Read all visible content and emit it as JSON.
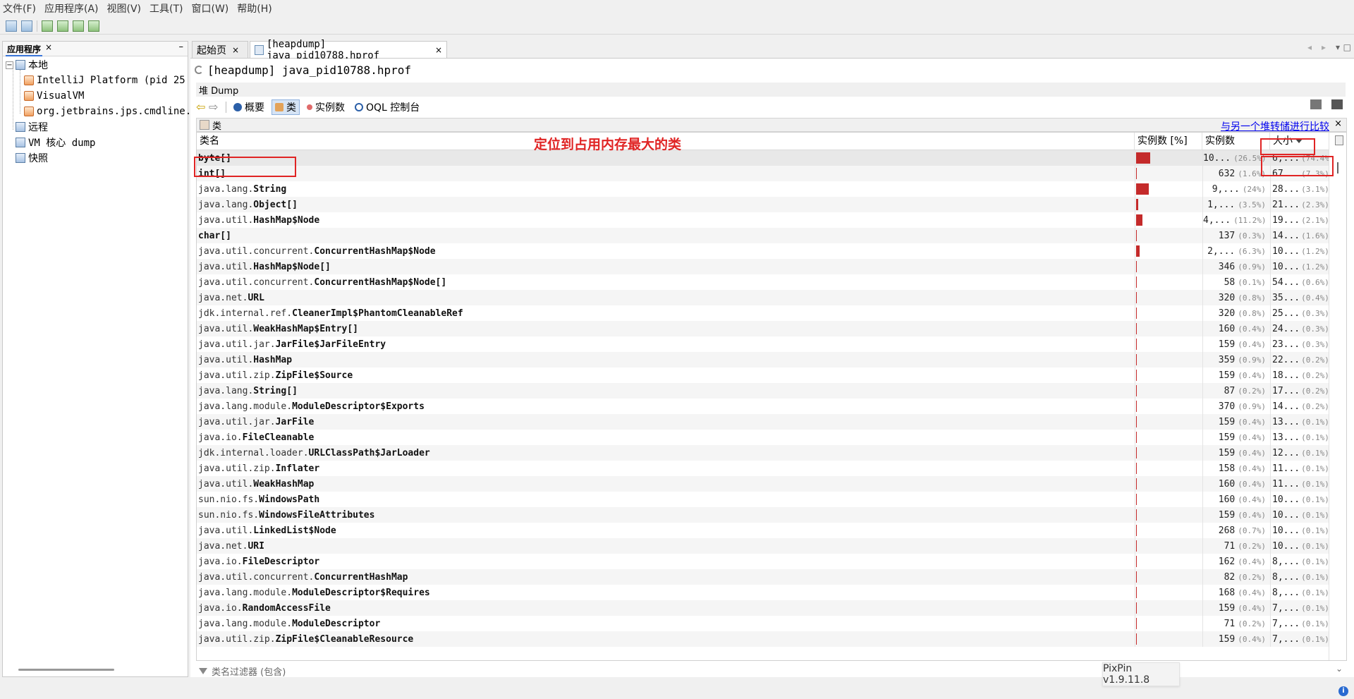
{
  "menubar": [
    "文件(F)",
    "应用程序(A)",
    "视图(V)",
    "工具(T)",
    "窗口(W)",
    "帮助(H)"
  ],
  "left_panel": {
    "tab_label": "应用程序",
    "tab_close": "×",
    "minimize": "–",
    "tree": {
      "local": "本地",
      "intellij": "IntelliJ Platform (pid 25",
      "visualvm": "VisualVM",
      "jps": "org.jetbrains.jps.cmdline.",
      "remote": "远程",
      "vm_core": "VM 核心 dump",
      "snapshot": "快照"
    }
  },
  "editor_tabs": {
    "start_page": "起始页",
    "heapdump": "[heapdump] java_pid10788.hprof",
    "close": "×"
  },
  "document": {
    "title": "[heapdump] java_pid10788.hprof",
    "heap_label": "堆 Dump",
    "views": {
      "summary": "概要",
      "classes": "类",
      "instances": "实例数",
      "oql": "OQL 控制台"
    }
  },
  "classes_panel": {
    "title": "类",
    "compare_link": "与另一个堆转储进行比较",
    "close": "×"
  },
  "table": {
    "headers": {
      "class_name": "类名",
      "instances_pct": "实例数 [%]",
      "instances": "实例数",
      "size": "大小"
    },
    "sort_column": "size",
    "rows": [
      {
        "pkg": "",
        "cls": "byte[]",
        "bar": 0.265,
        "count": "10...",
        "count_pct": "(26.5%)",
        "size": "6,...",
        "size_pct": "(74.4%)"
      },
      {
        "pkg": "",
        "cls": "int[]",
        "bar": 0.016,
        "count": "632",
        "count_pct": "(1.6%)",
        "size": "67...",
        "size_pct": "(7.3%)"
      },
      {
        "pkg": "java.lang.",
        "cls": "String",
        "bar": 0.24,
        "count": "9,...",
        "count_pct": "(24%)",
        "size": "28...",
        "size_pct": "(3.1%)"
      },
      {
        "pkg": "java.lang.",
        "cls": "Object[]",
        "bar": 0.035,
        "count": "1,...",
        "count_pct": "(3.5%)",
        "size": "21...",
        "size_pct": "(2.3%)"
      },
      {
        "pkg": "java.util.",
        "cls": "HashMap$Node",
        "bar": 0.112,
        "count": "4,...",
        "count_pct": "(11.2%)",
        "size": "19...",
        "size_pct": "(2.1%)"
      },
      {
        "pkg": "",
        "cls": "char[]",
        "bar": 0.003,
        "count": "137",
        "count_pct": "(0.3%)",
        "size": "14...",
        "size_pct": "(1.6%)"
      },
      {
        "pkg": "java.util.concurrent.",
        "cls": "ConcurrentHashMap$Node",
        "bar": 0.063,
        "count": "2,...",
        "count_pct": "(6.3%)",
        "size": "10...",
        "size_pct": "(1.2%)"
      },
      {
        "pkg": "java.util.",
        "cls": "HashMap$Node[]",
        "bar": 0.009,
        "count": "346",
        "count_pct": "(0.9%)",
        "size": "10...",
        "size_pct": "(1.2%)"
      },
      {
        "pkg": "java.util.concurrent.",
        "cls": "ConcurrentHashMap$Node[]",
        "bar": 0.001,
        "count": "58",
        "count_pct": "(0.1%)",
        "size": "54...",
        "size_pct": "(0.6%)"
      },
      {
        "pkg": "java.net.",
        "cls": "URL",
        "bar": 0.008,
        "count": "320",
        "count_pct": "(0.8%)",
        "size": "35...",
        "size_pct": "(0.4%)"
      },
      {
        "pkg": "jdk.internal.ref.",
        "cls": "CleanerImpl$PhantomCleanableRef",
        "bar": 0.008,
        "count": "320",
        "count_pct": "(0.8%)",
        "size": "25...",
        "size_pct": "(0.3%)"
      },
      {
        "pkg": "java.util.",
        "cls": "WeakHashMap$Entry[]",
        "bar": 0.004,
        "count": "160",
        "count_pct": "(0.4%)",
        "size": "24...",
        "size_pct": "(0.3%)"
      },
      {
        "pkg": "java.util.jar.",
        "cls": "JarFile$JarFileEntry",
        "bar": 0.004,
        "count": "159",
        "count_pct": "(0.4%)",
        "size": "23...",
        "size_pct": "(0.3%)"
      },
      {
        "pkg": "java.util.",
        "cls": "HashMap",
        "bar": 0.009,
        "count": "359",
        "count_pct": "(0.9%)",
        "size": "22...",
        "size_pct": "(0.2%)"
      },
      {
        "pkg": "java.util.zip.",
        "cls": "ZipFile$Source",
        "bar": 0.004,
        "count": "159",
        "count_pct": "(0.4%)",
        "size": "18...",
        "size_pct": "(0.2%)"
      },
      {
        "pkg": "java.lang.",
        "cls": "String[]",
        "bar": 0.002,
        "count": "87",
        "count_pct": "(0.2%)",
        "size": "17...",
        "size_pct": "(0.2%)"
      },
      {
        "pkg": "java.lang.module.",
        "cls": "ModuleDescriptor$Exports",
        "bar": 0.009,
        "count": "370",
        "count_pct": "(0.9%)",
        "size": "14...",
        "size_pct": "(0.2%)"
      },
      {
        "pkg": "java.util.jar.",
        "cls": "JarFile",
        "bar": 0.004,
        "count": "159",
        "count_pct": "(0.4%)",
        "size": "13...",
        "size_pct": "(0.1%)"
      },
      {
        "pkg": "java.io.",
        "cls": "FileCleanable",
        "bar": 0.004,
        "count": "159",
        "count_pct": "(0.4%)",
        "size": "13...",
        "size_pct": "(0.1%)"
      },
      {
        "pkg": "jdk.internal.loader.",
        "cls": "URLClassPath$JarLoader",
        "bar": 0.004,
        "count": "159",
        "count_pct": "(0.4%)",
        "size": "12...",
        "size_pct": "(0.1%)"
      },
      {
        "pkg": "java.util.zip.",
        "cls": "Inflater",
        "bar": 0.004,
        "count": "158",
        "count_pct": "(0.4%)",
        "size": "11...",
        "size_pct": "(0.1%)"
      },
      {
        "pkg": "java.util.",
        "cls": "WeakHashMap",
        "bar": 0.004,
        "count": "160",
        "count_pct": "(0.4%)",
        "size": "11...",
        "size_pct": "(0.1%)"
      },
      {
        "pkg": "sun.nio.fs.",
        "cls": "WindowsPath",
        "bar": 0.004,
        "count": "160",
        "count_pct": "(0.4%)",
        "size": "10...",
        "size_pct": "(0.1%)"
      },
      {
        "pkg": "sun.nio.fs.",
        "cls": "WindowsFileAttributes",
        "bar": 0.004,
        "count": "159",
        "count_pct": "(0.4%)",
        "size": "10...",
        "size_pct": "(0.1%)"
      },
      {
        "pkg": "java.util.",
        "cls": "LinkedList$Node",
        "bar": 0.007,
        "count": "268",
        "count_pct": "(0.7%)",
        "size": "10...",
        "size_pct": "(0.1%)"
      },
      {
        "pkg": "java.net.",
        "cls": "URI",
        "bar": 0.002,
        "count": "71",
        "count_pct": "(0.2%)",
        "size": "10...",
        "size_pct": "(0.1%)"
      },
      {
        "pkg": "java.io.",
        "cls": "FileDescriptor",
        "bar": 0.004,
        "count": "162",
        "count_pct": "(0.4%)",
        "size": "8,...",
        "size_pct": "(0.1%)"
      },
      {
        "pkg": "java.util.concurrent.",
        "cls": "ConcurrentHashMap",
        "bar": 0.002,
        "count": "82",
        "count_pct": "(0.2%)",
        "size": "8,...",
        "size_pct": "(0.1%)"
      },
      {
        "pkg": "java.lang.module.",
        "cls": "ModuleDescriptor$Requires",
        "bar": 0.004,
        "count": "168",
        "count_pct": "(0.4%)",
        "size": "8,...",
        "size_pct": "(0.1%)"
      },
      {
        "pkg": "java.io.",
        "cls": "RandomAccessFile",
        "bar": 0.004,
        "count": "159",
        "count_pct": "(0.4%)",
        "size": "7,...",
        "size_pct": "(0.1%)"
      },
      {
        "pkg": "java.lang.module.",
        "cls": "ModuleDescriptor",
        "bar": 0.002,
        "count": "71",
        "count_pct": "(0.2%)",
        "size": "7,...",
        "size_pct": "(0.1%)"
      },
      {
        "pkg": "java.util.zip.",
        "cls": "ZipFile$CleanableResource",
        "bar": 0.004,
        "count": "159",
        "count_pct": "(0.4%)",
        "size": "7,...",
        "size_pct": "(0.1%)"
      }
    ]
  },
  "filter": {
    "placeholder": "类名过滤器 (包含)"
  },
  "annotation": {
    "text": "定位到占用内存最大的类",
    "color": "#e02424"
  },
  "pixpin_label": "PixPin v1.9.11.8",
  "colors": {
    "bar": "#c42a2a",
    "link": "#0000ee",
    "active_view": "#d6e4f5"
  }
}
